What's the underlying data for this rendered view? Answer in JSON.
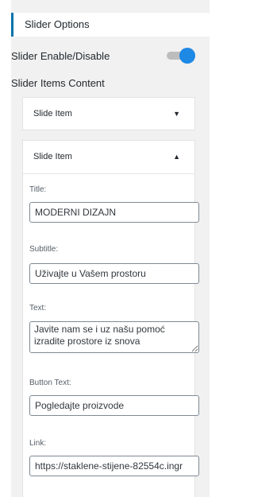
{
  "section": {
    "title": "Slider Options"
  },
  "slider_enable": {
    "label": "Slider Enable/Disable",
    "enabled": true
  },
  "items_content": {
    "label": "Slider Items Content"
  },
  "collapsed_item": {
    "title": "Slide Item",
    "caret": "▼"
  },
  "expanded_item": {
    "title": "Slide Item",
    "caret": "▲",
    "fields": {
      "title": {
        "label": "Title:",
        "value": "MODERNI DIZAJN"
      },
      "subtitle": {
        "label": "Subtitle:",
        "value": "Uživajte u Vašem prostoru"
      },
      "text": {
        "label": "Text:",
        "value": "Javite nam se i uz našu pomoć izradite prostore iz snova"
      },
      "button_text": {
        "label": "Button Text:",
        "value": "Pogledajte proizvode"
      },
      "link": {
        "label": "Link:",
        "value": "https://staklene-stijene-82554c.ingr"
      }
    }
  },
  "colors": {
    "accent": "#0073aa",
    "toggle_on": "#1e88e5",
    "panel_bg": "#f1f1f1"
  }
}
